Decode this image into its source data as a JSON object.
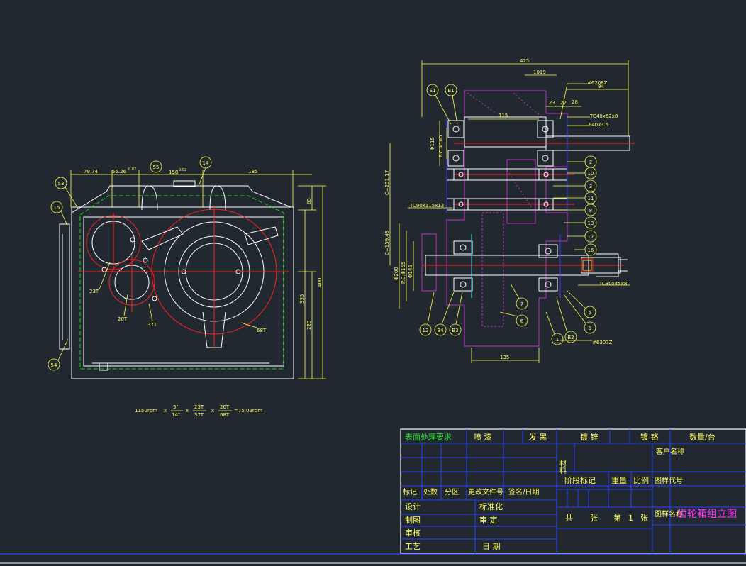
{
  "front_view": {
    "dims": {
      "d1": "79.74",
      "d2": "55.26",
      "d2_tol": "0.02",
      "d3": "158",
      "d3_tol": "0.02",
      "d4": "185",
      "d5": "65",
      "d6": "400",
      "d7": "335",
      "d8": "220"
    },
    "balloons": [
      "53",
      "15",
      "55",
      "14",
      "54"
    ],
    "gear_labels": [
      "23T",
      "20T",
      "37T",
      "68T"
    ]
  },
  "formula": {
    "rpm_in": "1150rpm",
    "op": "x",
    "f1_num": "5\"",
    "f1_den": "14\"",
    "f2_num": "23T",
    "f2_den": "37T",
    "f3_num": "20T",
    "f3_den": "68T",
    "result": "=75.09rpm"
  },
  "section_view": {
    "dims": {
      "top": "425",
      "d_1019": "1019",
      "d_115": "115",
      "d_23": "23",
      "d_22": "22",
      "d_28": "28",
      "d_94": "94",
      "bottom": "135",
      "v1": "Φ115",
      "v2": "P.C.Φ100",
      "v3": "C=251.17",
      "v4": "C=159.43",
      "v5": "Φ200",
      "v6": "P.C.Φ165",
      "v7": "Φ145"
    },
    "notes": {
      "n1": "#6208Z",
      "n2": "TC40x62x8",
      "n3": "P40x3.5",
      "n4": "TC90x115x13",
      "n5": "TC30x45x8",
      "n6": "#6307Z"
    },
    "balloons": [
      "S1",
      "B1",
      "2",
      "10",
      "3",
      "11",
      "8",
      "13",
      "17",
      "16",
      "5",
      "9",
      "7",
      "6",
      "1",
      "B2",
      "12",
      "B4",
      "B3"
    ]
  },
  "title_block": {
    "r1": [
      "表面处理要求",
      "喷 漆",
      "发 黑",
      "镀 锌",
      "镀 铬",
      "数量/台"
    ],
    "material": "材料",
    "customer": "客户名称",
    "stage": "阶段标记",
    "weight": "重量",
    "scale": "比例",
    "drawing_code": "图样代号",
    "drawing_name_label": "图样名称",
    "drawing_name": "齿轮箱组立图",
    "rev_headers": [
      "标记",
      "处数",
      "分区",
      "更改文件号",
      "签名/日期"
    ],
    "design": "设计",
    "standard": "标准化",
    "drawn": "制图",
    "approve": "审 定",
    "check": "审核",
    "process": "工艺",
    "date": "日 期",
    "total_sheets": "共",
    "sheets_word": "张",
    "sheet_no": "第",
    "sheet_num": "1",
    "sheet_word2": "张"
  }
}
